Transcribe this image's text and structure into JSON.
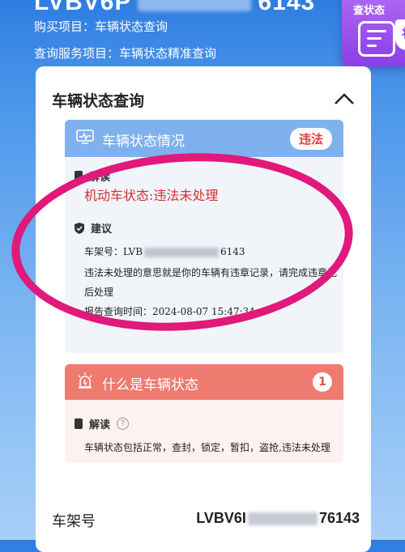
{
  "header": {
    "plate_prefix": "LVBV6P",
    "plate_suffix": "6143",
    "purchase_line": "购买项目：车辆状态查询",
    "service_line": "查询服务项目：车辆状态精准查询",
    "badge_label": "查状态",
    "badge_shield_char": "状"
  },
  "card": {
    "title": "车辆状态查询"
  },
  "status_panel": {
    "title": "车辆状态情况",
    "tag": "违法",
    "interpret_label": "解读",
    "status_text": "机动车状态:违法未处理",
    "advice_label": "建议",
    "vin_prefix": "车架号：LVB",
    "vin_suffix": "6143",
    "advice_line1": "违法未处理的意思就是你的车辆有违章记录，请完成违章记",
    "advice_line2": "后处理",
    "report_time": "报告查询时间：2024-08-07 15:47:34"
  },
  "info_panel": {
    "title": "什么是车辆状态",
    "count": "1",
    "interpret_label": "解读",
    "help_mark": "?",
    "text": "车辆状态包括正常，查封，锁定，暂扣，盗抢,违法未处理"
  },
  "vin_row": {
    "label": "车架号",
    "value_prefix": "LVBV6I",
    "value_suffix": "76143"
  },
  "colors": {
    "accent_blue": "#7fb1ee",
    "alert_red": "#d92d2d",
    "panel2_head": "#ee7a70",
    "annotation_ring": "#e0197a"
  }
}
